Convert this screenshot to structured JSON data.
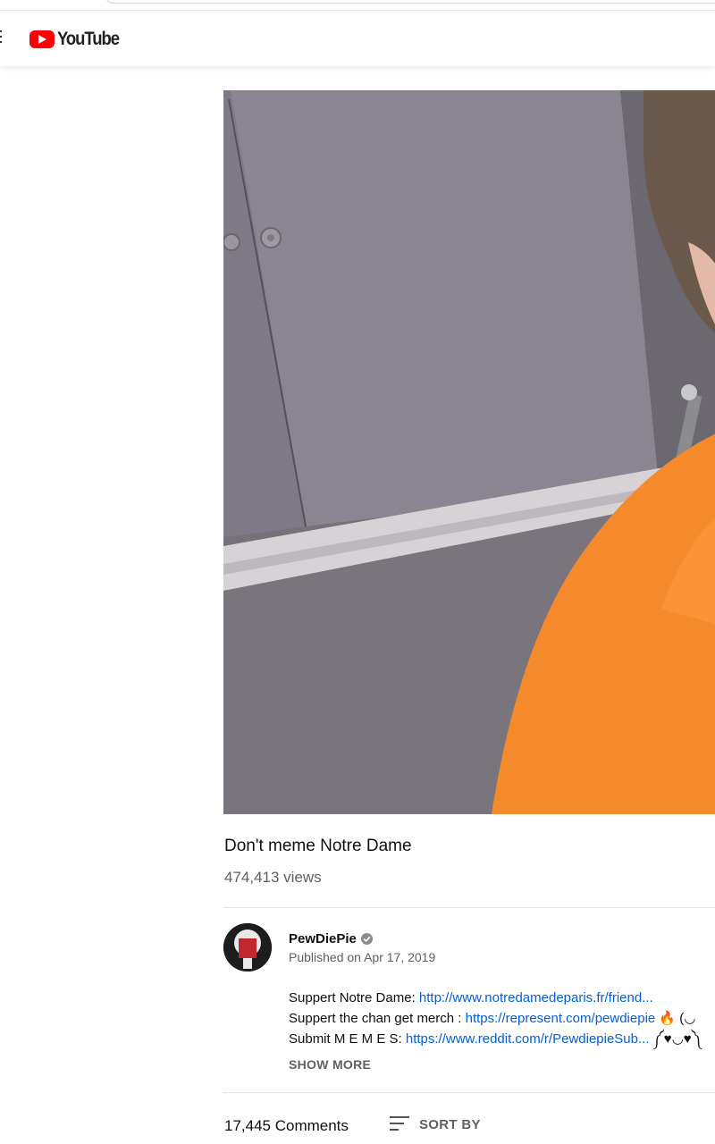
{
  "header": {
    "logo_text": "YouTube",
    "brand_color": "#ff0000"
  },
  "video": {
    "title": "Don't meme Notre Dame",
    "views": "474,413 views"
  },
  "channel": {
    "name": "PewDiePie",
    "published": "Published on Apr 17, 2019",
    "verified_icon": "check-circle-icon"
  },
  "description": {
    "lines": [
      {
        "prefix": "Suppert Notre Dame: ",
        "link": "http://www.notredamedeparis.fr/friend...",
        "suffix": ""
      },
      {
        "prefix": "Suppert the chan get merch  : ",
        "link": "https://represent.com/pewdiepie",
        "suffix": " 🔥 (◡"
      },
      {
        "prefix": "Submit M E M E S: ",
        "link": "https://www.reddit.com/r/PewdiepieSub...",
        "suffix": " ༼♥◡♥༽"
      }
    ],
    "show_more": "SHOW MORE"
  },
  "comments": {
    "count": "17,445 Comments",
    "sort_label": "SORT BY"
  },
  "colors": {
    "link": "#065fd4",
    "secondary_text": "#606060",
    "shirt_orange": "#f58a2d"
  }
}
